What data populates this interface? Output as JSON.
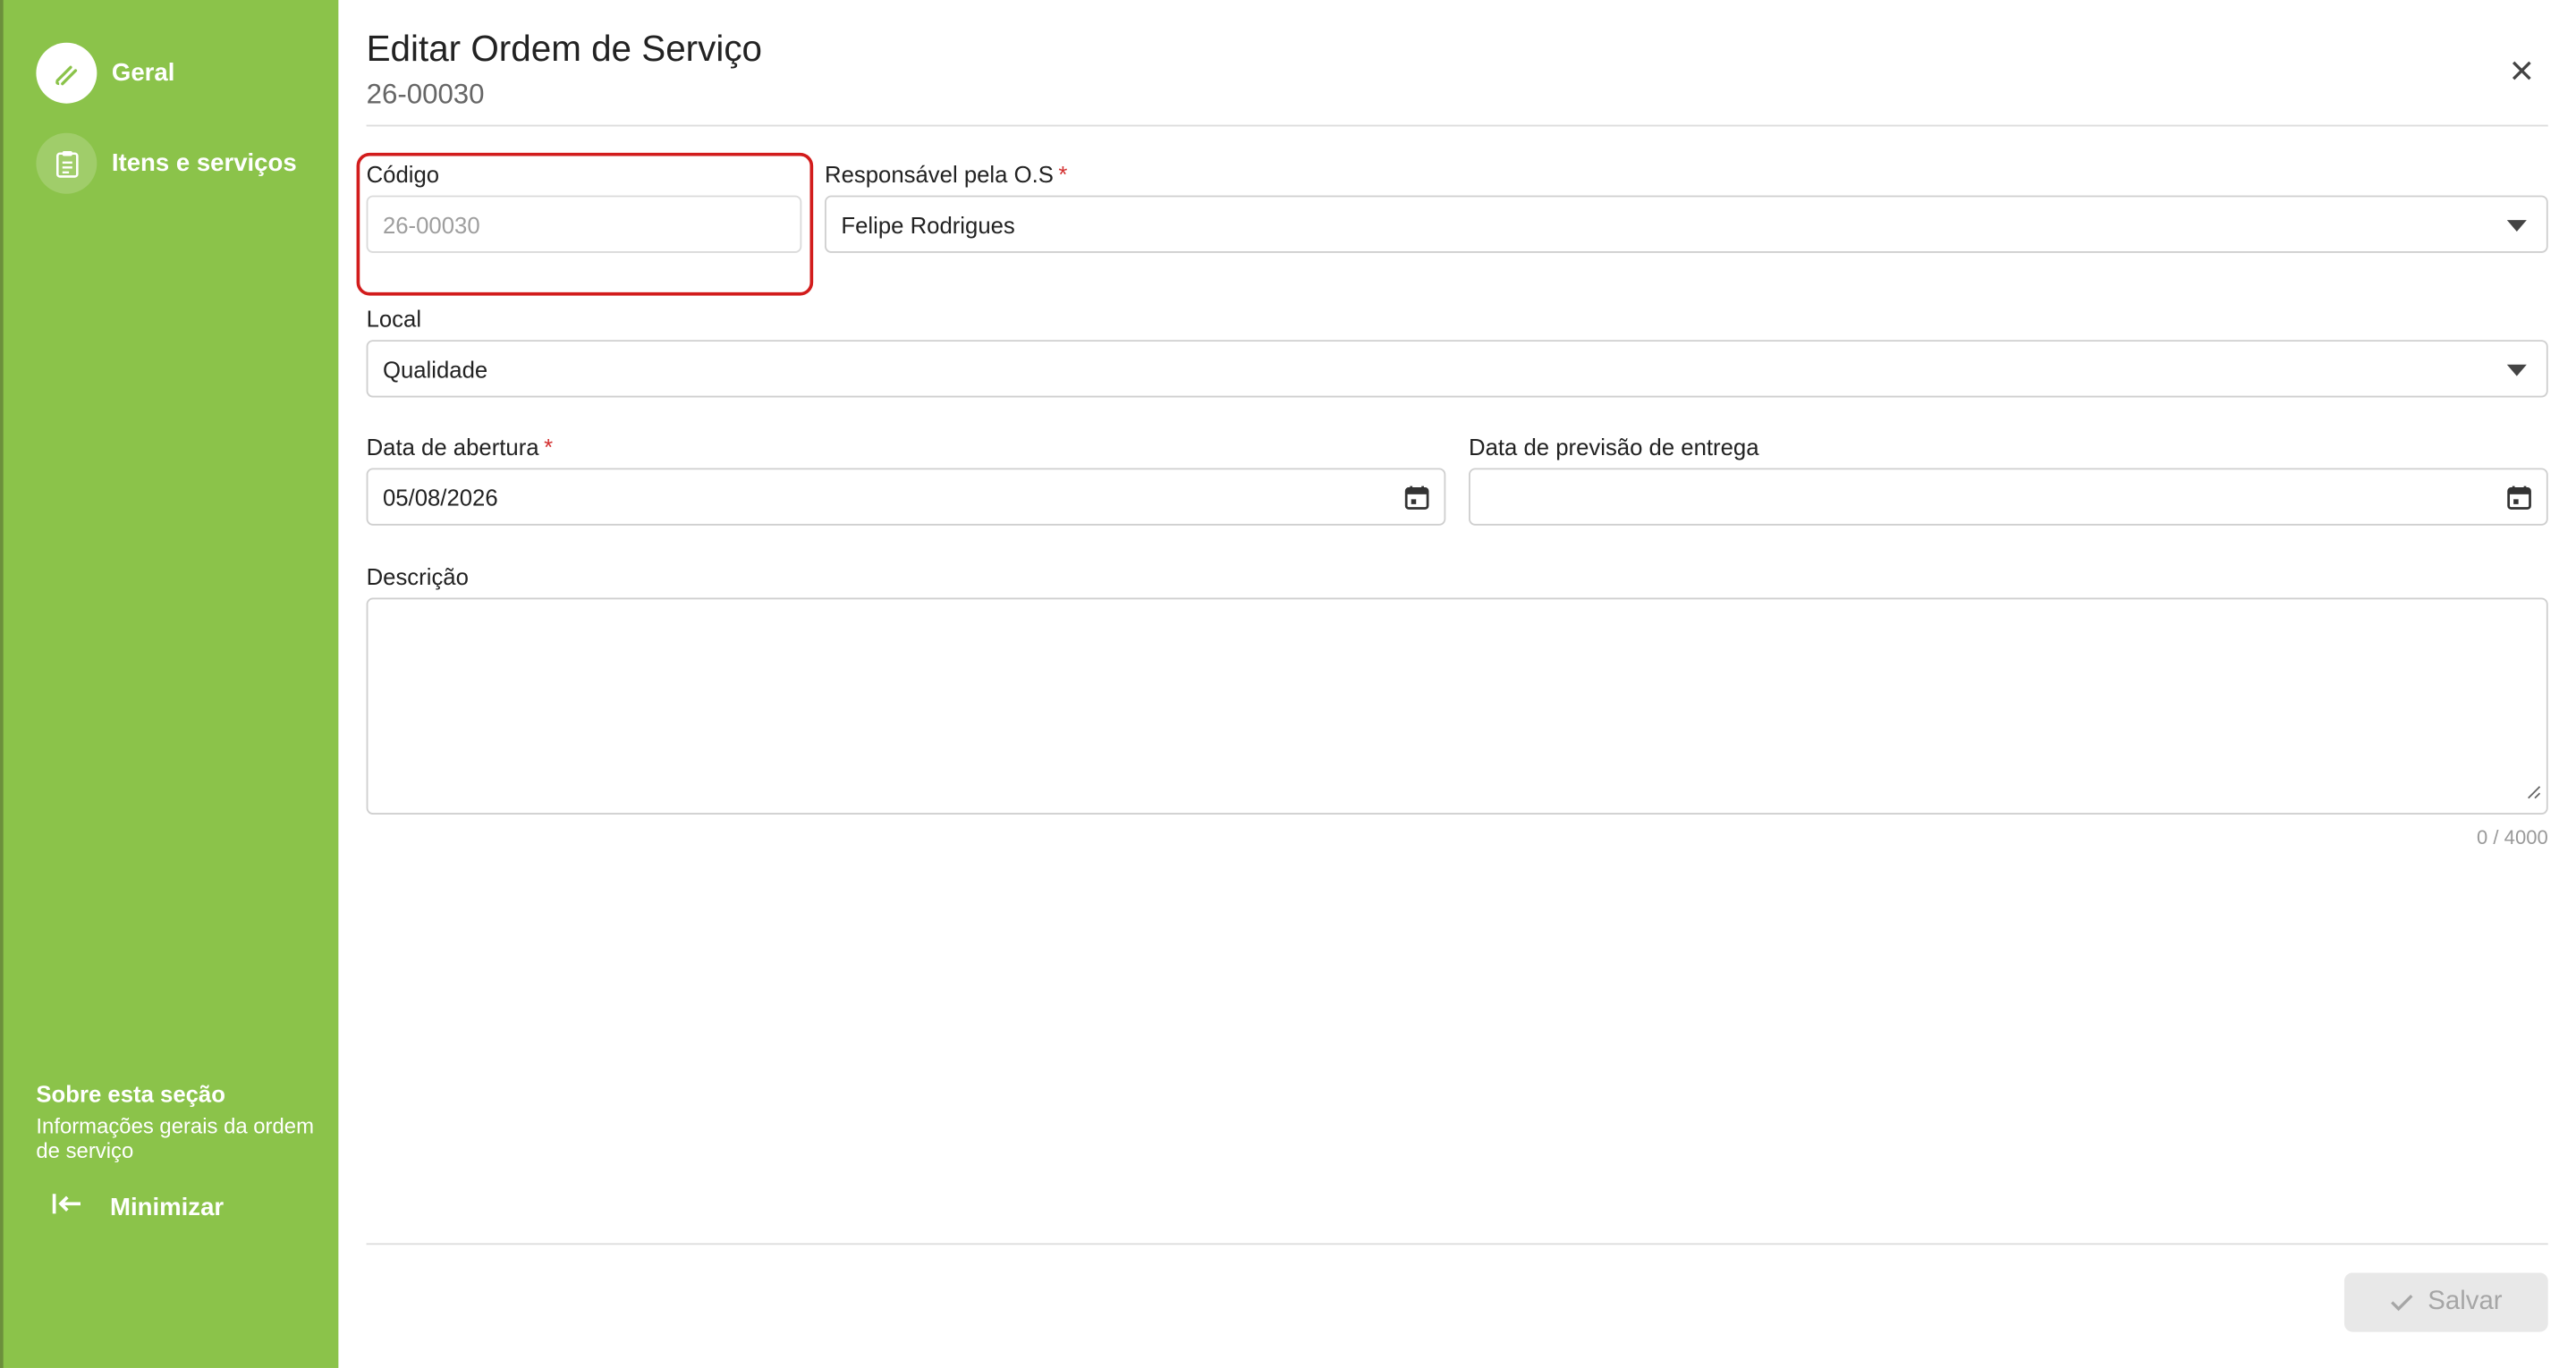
{
  "sidebar": {
    "items": [
      {
        "label": "Geral",
        "icon": "edit-pen-icon",
        "active": true
      },
      {
        "label": "Itens e serviços",
        "icon": "clipboard-list-icon",
        "active": false
      }
    ],
    "about_title": "Sobre esta seção",
    "about_text": "Informações gerais da ordem de serviço",
    "minimize_label": "Minimizar",
    "color": "#8bc34a"
  },
  "header": {
    "title": "Editar Ordem de Serviço",
    "subtitle": "26-00030"
  },
  "form": {
    "codigo": {
      "label": "Código",
      "value": "26-00030"
    },
    "responsavel": {
      "label": "Responsável pela O.S",
      "required_mark": "*",
      "value": "Felipe Rodrigues"
    },
    "local": {
      "label": "Local",
      "value": "Qualidade"
    },
    "data_abertura": {
      "label": "Data de abertura",
      "required_mark": "*",
      "value": "05/08/2026"
    },
    "data_previsao": {
      "label": "Data de previsão de entrega",
      "value": ""
    },
    "descricao": {
      "label": "Descrição",
      "value": "",
      "counter": "0 / 4000"
    }
  },
  "footer": {
    "save_label": "Salvar"
  },
  "colors": {
    "highlight": "#d21c1c",
    "required": "#d32f2f"
  }
}
